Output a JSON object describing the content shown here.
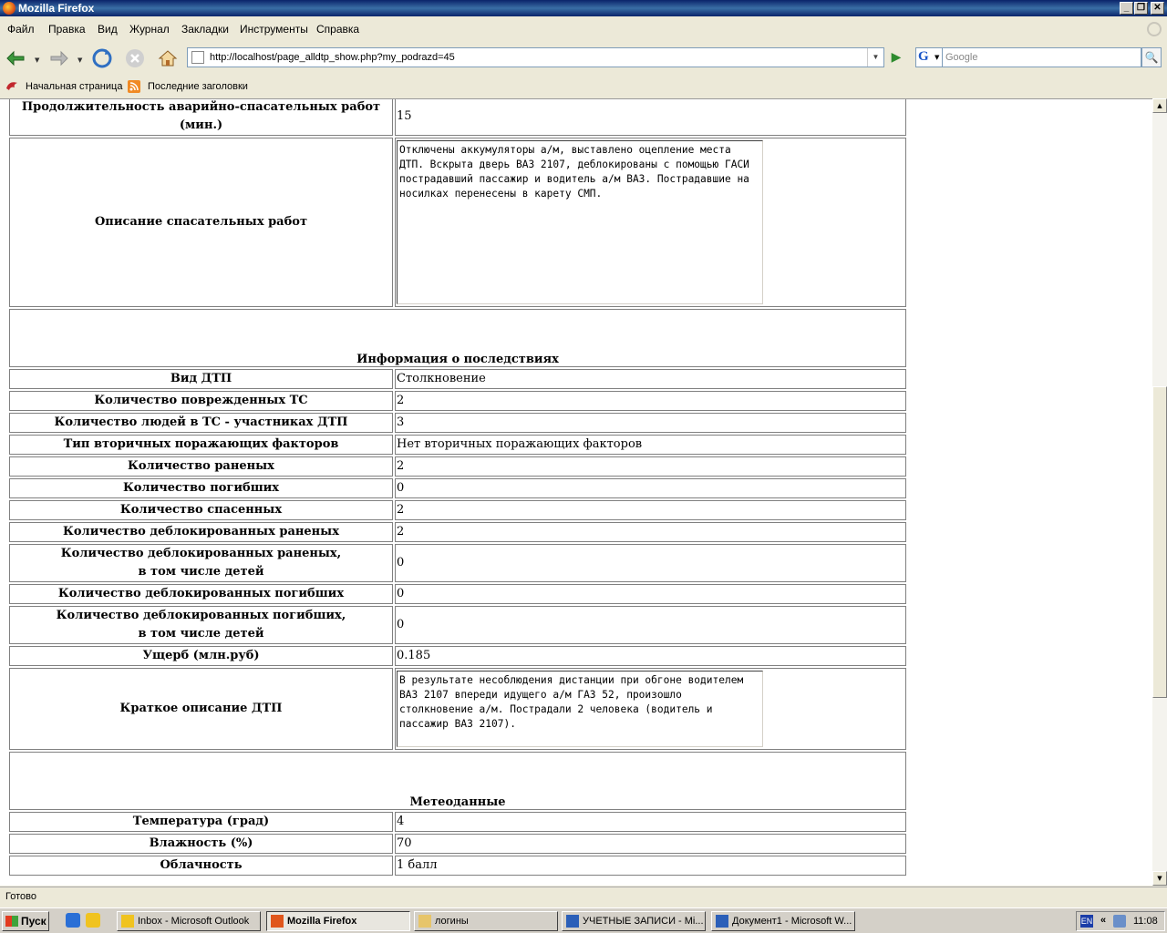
{
  "window": {
    "title": "Mozilla Firefox"
  },
  "menu": [
    "Файл",
    "Правка",
    "Вид",
    "Журнал",
    "Закладки",
    "Инструменты",
    "Справка"
  ],
  "nav": {
    "url": "http://localhost/page_alldtp_show.php?my_podrazd=45",
    "search_placeholder": "Google"
  },
  "bookmarks": [
    "Начальная страница",
    "Последние заголовки"
  ],
  "rows_top": [
    {
      "label": "Продолжительность аварийно-спасательных работ (мин.)",
      "value": "15"
    }
  ],
  "rescue": {
    "label": "Описание спасательных работ",
    "text": "Отключены аккумуляторы а/м, выставлено оцепление места ДТП. Вскрыта дверь ВАЗ 2107, деблокированы с помощью ГАСИ пострадавший пассажир и водитель а/м ВАЗ. Пострадавшие на носилках перенесены в карету СМП."
  },
  "section_consequences": "Информация о последствиях",
  "rows_consequences": [
    {
      "label": "Вид ДТП",
      "value": "Столкновение"
    },
    {
      "label": "Количество поврежденных ТС",
      "value": "2"
    },
    {
      "label": "Количество людей в ТС - участниках ДТП",
      "value": "3"
    },
    {
      "label": "Тип вторичных поражающих факторов",
      "value": "Нет вторичных поражающих факторов"
    },
    {
      "label": "Количество раненых",
      "value": "2"
    },
    {
      "label": "Количество погибших",
      "value": "0"
    },
    {
      "label": "Количество спасенных",
      "value": "2"
    },
    {
      "label": "Количество деблокированных раненых",
      "value": "2"
    },
    {
      "label": "Количество деблокированных раненых,\nв том числе детей",
      "value": "0"
    },
    {
      "label": "Количество деблокированных погибших",
      "value": "0"
    },
    {
      "label": "Количество деблокированных погибших,\nв том числе детей",
      "value": "0"
    },
    {
      "label": "Ущерб (млн.руб)",
      "value": "0.185"
    }
  ],
  "summary": {
    "label": "Краткое описание ДТП",
    "text": "В результате несоблюдения дистанции при обгоне водителем ВАЗ 2107 впереди идущего а/м ГАЗ 52, произошло столкновение а/м. Пострадали 2 человека (водитель и пассажир ВАЗ 2107)."
  },
  "section_meteo": "Метеоданные",
  "rows_meteo": [
    {
      "label": "Температура (град)",
      "value": "4"
    },
    {
      "label": "Влажность (%)",
      "value": "70"
    },
    {
      "label": "Облачность",
      "value": "1 балл"
    }
  ],
  "status": "Готово",
  "taskbar": {
    "start": "Пуск",
    "tasks": [
      {
        "label": "Inbox - Microsoft Outlook",
        "active": false
      },
      {
        "label": "Mozilla Firefox",
        "active": true
      },
      {
        "label": "логины",
        "active": false
      },
      {
        "label": "УЧЕТНЫЕ ЗАПИСИ - Mi...",
        "active": false
      },
      {
        "label": "Документ1 - Microsoft W...",
        "active": false
      }
    ],
    "lang": "EN",
    "clock": "11:08"
  },
  "colors": {
    "title_bar": "#0A246A",
    "chrome": "#ECE9D8",
    "taskbar": "#D4D0C8"
  }
}
